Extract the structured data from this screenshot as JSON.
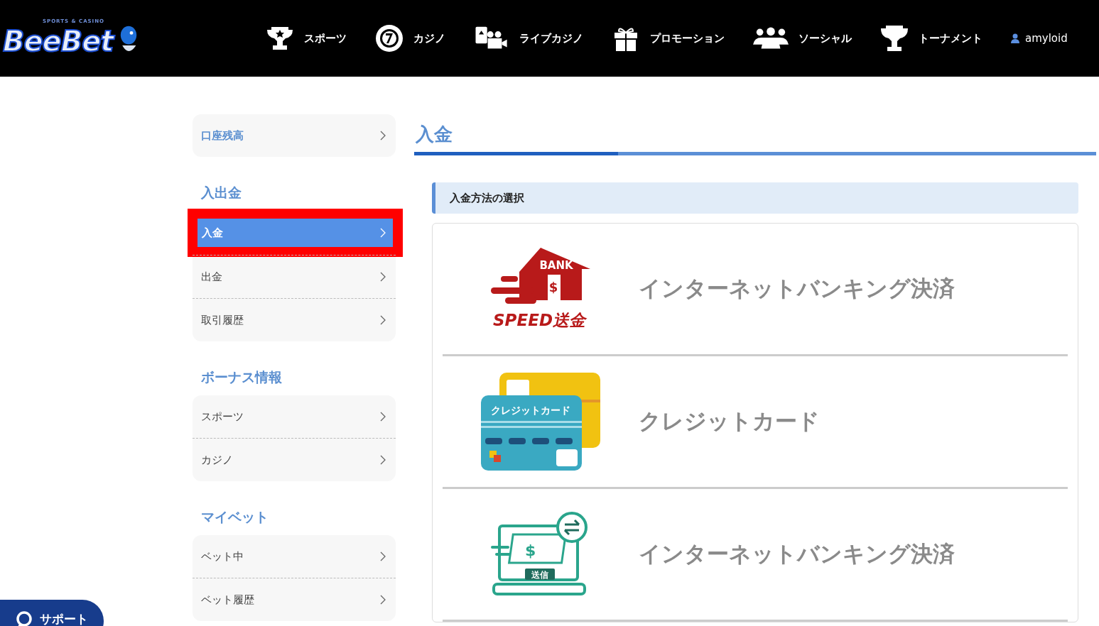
{
  "header": {
    "logo": {
      "tagline": "SPORTS & CASINO",
      "name": "BeeBet"
    },
    "nav": [
      {
        "kind": "trophy",
        "label": "スポーツ"
      },
      {
        "kind": "chip",
        "label": "カジノ"
      },
      {
        "kind": "live",
        "label": "ライブカジノ"
      },
      {
        "kind": "gift",
        "label": "プロモーション"
      },
      {
        "kind": "people",
        "label": "ソーシャル"
      },
      {
        "kind": "cup",
        "label": "トーナメント"
      }
    ],
    "user": "amyloid"
  },
  "sidebar": [
    {
      "items": [
        {
          "label": "口座残高",
          "selected": false,
          "kind": "link"
        }
      ]
    },
    {
      "heading": "入出金",
      "items": [
        {
          "label": "入金",
          "selected": true,
          "kind": "item"
        },
        {
          "label": "出金",
          "selected": false,
          "kind": "item"
        },
        {
          "label": "取引履歴",
          "selected": false,
          "kind": "item"
        }
      ]
    },
    {
      "heading": "ボーナス情報",
      "items": [
        {
          "label": "スポーツ",
          "selected": false,
          "kind": "item"
        },
        {
          "label": "カジノ",
          "selected": false,
          "kind": "item"
        }
      ]
    },
    {
      "heading": "マイベット",
      "items": [
        {
          "label": "ベット中",
          "selected": false,
          "kind": "item"
        },
        {
          "label": "ベット履歴",
          "selected": false,
          "kind": "item"
        }
      ]
    }
  ],
  "page": {
    "title": "入金",
    "section": "入金方法の選択",
    "methods": [
      {
        "kind": "bank",
        "art": [
          "BANK",
          "SPEED送金",
          "$"
        ],
        "label": "インターネットバンキング決済"
      },
      {
        "kind": "card",
        "art": [
          "クレジットカード"
        ],
        "label": "クレジットカード"
      },
      {
        "kind": "transfer",
        "art": [
          "送信",
          "$"
        ],
        "label": "インターネットバンキング決済"
      }
    ]
  },
  "support": "サポート"
}
